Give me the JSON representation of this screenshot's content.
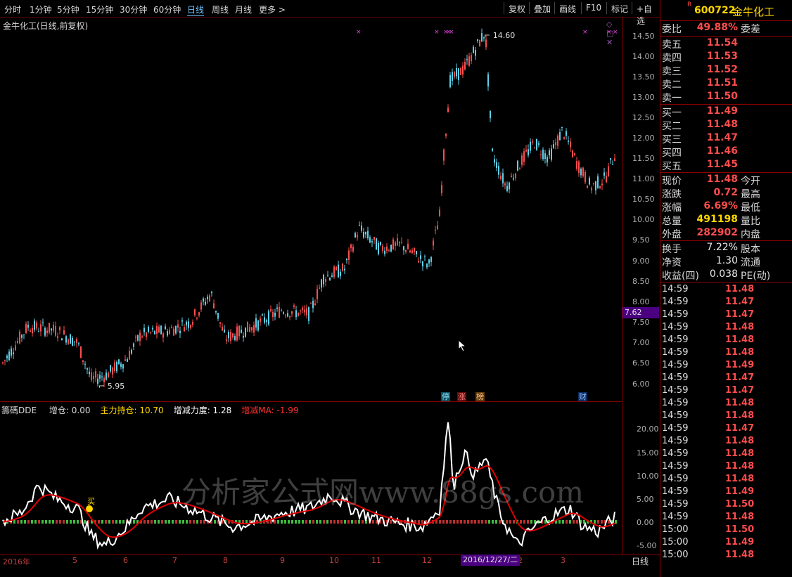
{
  "toolbar": {
    "periods": [
      "分时",
      "1分钟",
      "5分钟",
      "15分钟",
      "30分钟",
      "60分钟",
      "日线",
      "周线",
      "月线",
      "更多 >"
    ],
    "active_period": "日线",
    "right_buttons": [
      "复权",
      "叠加",
      "画线",
      "F10",
      "标记",
      "+自选"
    ]
  },
  "chart_title": "金牛化工(日线,前复权)",
  "price_axis": [
    "14.50",
    "14.00",
    "13.50",
    "13.00",
    "12.50",
    "12.00",
    "11.50",
    "11.00",
    "10.50",
    "10.00",
    "9.50",
    "9.00",
    "8.50",
    "8.00",
    "7.50",
    "7.00",
    "6.50",
    "6.00"
  ],
  "annotations": {
    "high_label": "14.60",
    "low_label": "5.95",
    "cursor_price": "7.62",
    "markers": [
      "停",
      "涨",
      "榜",
      "财"
    ]
  },
  "indicator": {
    "name": "籌碼DDE",
    "items": [
      {
        "label": "增仓: 0.00",
        "color": "#d8d8d8"
      },
      {
        "label": "主力持仓: 10.70",
        "color": "#ffd700"
      },
      {
        "label": "增减力度: 1.28",
        "color": "#ffffff"
      },
      {
        "label": "增减MA: -1.99",
        "color": "#ff3030"
      }
    ],
    "axis": [
      "20.00",
      "15.00",
      "10.00",
      "5.00",
      "0.00",
      "-5.00"
    ],
    "buy_label": "买"
  },
  "date_axis": [
    "2016年",
    "5",
    "6",
    "7",
    "8",
    "9",
    "10",
    "11",
    "12",
    "2",
    "3"
  ],
  "date_cursor": "2016/12/27/二",
  "date_axis_right": "日线",
  "watermark": "分析家公式网www.88gs.com",
  "stock": {
    "code": "600722",
    "name": "金牛化工",
    "flag": "R"
  },
  "quote": {
    "weibi": {
      "label": "委比",
      "value": "49.88%",
      "label2": "委差"
    },
    "asks": [
      {
        "label": "卖五",
        "price": "11.54"
      },
      {
        "label": "卖四",
        "price": "11.53"
      },
      {
        "label": "卖三",
        "price": "11.52"
      },
      {
        "label": "卖二",
        "price": "11.51"
      },
      {
        "label": "卖一",
        "price": "11.50"
      }
    ],
    "bids": [
      {
        "label": "买一",
        "price": "11.49"
      },
      {
        "label": "买二",
        "price": "11.48"
      },
      {
        "label": "买三",
        "price": "11.47"
      },
      {
        "label": "买四",
        "price": "11.46"
      },
      {
        "label": "买五",
        "price": "11.45"
      }
    ],
    "stats": [
      {
        "label": "现价",
        "value": "11.48",
        "label2": "今开",
        "color": "#ff4d4d"
      },
      {
        "label": "涨跌",
        "value": "0.72",
        "label2": "最高",
        "color": "#ff4d4d"
      },
      {
        "label": "涨幅",
        "value": "6.69%",
        "label2": "最低",
        "color": "#ff4d4d"
      },
      {
        "label": "总量",
        "value": "491198",
        "label2": "量比",
        "color": "#ffd700"
      },
      {
        "label": "外盘",
        "value": "282902",
        "label2": "内盘",
        "color": "#ff4d4d"
      }
    ],
    "stats2": [
      {
        "label": "换手",
        "value": "7.22%",
        "label2": "股本"
      },
      {
        "label": "净资",
        "value": "1.30",
        "label2": "流通"
      },
      {
        "label": "收益(四)",
        "value": "0.038",
        "label2": "PE(动)"
      }
    ]
  },
  "ticks": [
    {
      "time": "14:59",
      "price": "11.48"
    },
    {
      "time": "14:59",
      "price": "11.47"
    },
    {
      "time": "14:59",
      "price": "11.47"
    },
    {
      "time": "14:59",
      "price": "11.48"
    },
    {
      "time": "14:59",
      "price": "11.48"
    },
    {
      "time": "14:59",
      "price": "11.48"
    },
    {
      "time": "14:59",
      "price": "11.49"
    },
    {
      "time": "14:59",
      "price": "11.47"
    },
    {
      "time": "14:59",
      "price": "11.47"
    },
    {
      "time": "14:59",
      "price": "11.48"
    },
    {
      "time": "14:59",
      "price": "11.48"
    },
    {
      "time": "14:59",
      "price": "11.47"
    },
    {
      "time": "14:59",
      "price": "11.48"
    },
    {
      "time": "14:59",
      "price": "11.48"
    },
    {
      "time": "14:59",
      "price": "11.48"
    },
    {
      "time": "14:59",
      "price": "11.48"
    },
    {
      "time": "14:59",
      "price": "11.49"
    },
    {
      "time": "14:59",
      "price": "11.50"
    },
    {
      "time": "14:59",
      "price": "11.48"
    },
    {
      "time": "15:00",
      "price": "11.50"
    },
    {
      "time": "15:00",
      "price": "11.49"
    },
    {
      "time": "15:00",
      "price": "11.48"
    }
  ],
  "colors": {
    "up": "#ff4d4d",
    "down": "#5ed0e8",
    "frame": "#8b0000",
    "cursor": "#4b0082"
  }
}
